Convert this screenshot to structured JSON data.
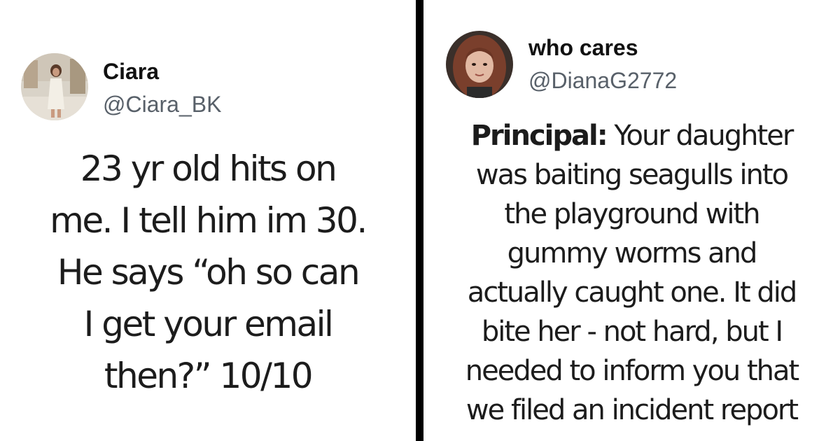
{
  "tweets": [
    {
      "author": {
        "display_name": "Ciara",
        "handle": "@Ciara_BK"
      },
      "body_lines": [
        "23 yr old hits on",
        "me. I tell him im 30.",
        "He says “oh so can",
        "I get your email",
        "then?” 10/10"
      ]
    },
    {
      "author": {
        "display_name": "who cares",
        "handle": "@DianaG2772"
      },
      "body_lead": "Principal:",
      "body_first_rest": " Your daughter",
      "body_lines": [
        "was baiting seagulls into",
        "the playground with",
        "gummy worms and",
        "actually caught one. It did",
        "bite her - not hard, but I",
        "needed to inform you that",
        "we filed an incident report"
      ]
    }
  ],
  "colors": {
    "background": "#ffffff",
    "divider": "#000000",
    "text": "#111111",
    "handle": "#586069"
  }
}
